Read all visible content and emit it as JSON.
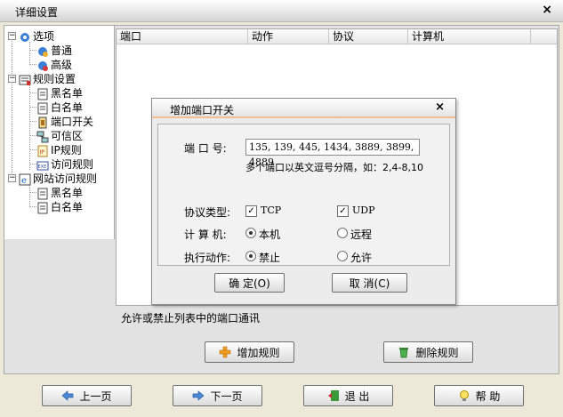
{
  "window": {
    "title": "详细设置",
    "close_glyph": "×"
  },
  "tree": {
    "options": "选项",
    "normal": "普通",
    "advanced": "高级",
    "rules": "规则设置",
    "blacklist": "黑名单",
    "whitelist": "白名单",
    "port_switch": "端口开关",
    "trusted": "可信区",
    "ip_rules": "IP规则",
    "access_rules": "访问规则",
    "web_rules": "网站访问规则",
    "web_blacklist": "黑名单",
    "web_whitelist": "白名单"
  },
  "table": {
    "columns": [
      "端口",
      "动作",
      "协议",
      "计算机"
    ]
  },
  "description": "允许或禁止列表中的端口通讯",
  "buttons": {
    "add_rule": "增加规则",
    "delete_rule": "删除规则"
  },
  "nav": {
    "prev": "上一页",
    "next": "下一页",
    "exit": "退 出",
    "help": "帮 助"
  },
  "dialog": {
    "title": "增加端口开关",
    "close_glyph": "×",
    "port_label": "端 口 号:",
    "port_value": "135, 139, 445, 1434, 3889, 3899, 4889",
    "port_hint": "多个端口以英文逗号分隔，如：2,4-8,10",
    "protocol_label": "协议类型:",
    "tcp": "TCP",
    "udp": "UDP",
    "computer_label": "计 算 机:",
    "local": "本机",
    "remote": "远程",
    "action_label": "执行动作:",
    "deny": "禁止",
    "allow": "允许",
    "ok": "确 定(O)",
    "cancel": "取 消(C)",
    "tcp_checked": true,
    "udp_checked": true,
    "computer_selected": "本机",
    "action_selected": "禁止"
  }
}
